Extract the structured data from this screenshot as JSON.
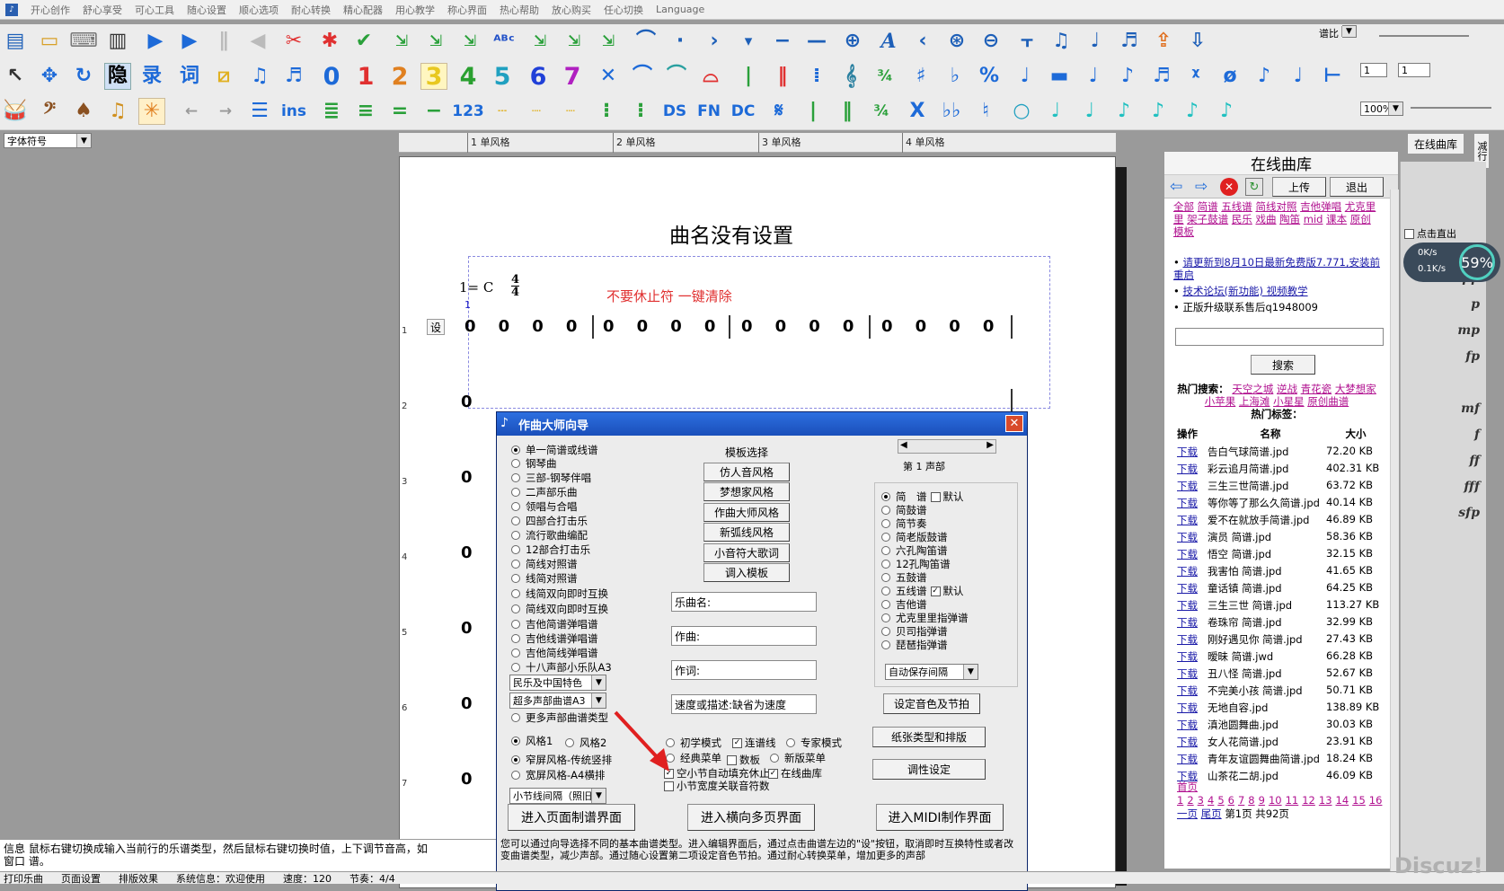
{
  "menu": [
    "开心创作",
    "舒心享受",
    "可心工具",
    "随心设置",
    "顺心选项",
    "耐心转换",
    "精心配器",
    "用心教学",
    "称心界面",
    "热心帮助",
    "放心购买",
    "任心切换",
    "Language"
  ],
  "toolbar_right": {
    "pubi_label": "谱比",
    "zoom": "100%",
    "field1": "1",
    "field2": "1"
  },
  "font_select": "字体符号",
  "ruler_labels": [
    "1 单风格",
    "2 单风格",
    "3 单风格",
    "4 单风格"
  ],
  "score": {
    "title": "曲名没有设置",
    "key": "1= C",
    "time_top": "4",
    "time_bottom": "4",
    "cursor_mark": "1",
    "notice": "不要休止符 一键清除",
    "set_label": "设",
    "measures": [
      [
        "0",
        "0",
        "0",
        "0"
      ],
      [
        "0",
        "0",
        "0",
        "0"
      ],
      [
        "0",
        "0",
        "0",
        "0"
      ],
      [
        "0",
        "0",
        "0",
        "0"
      ]
    ],
    "row_numbers": [
      "1",
      "2",
      "3",
      "4",
      "5",
      "6",
      "7"
    ],
    "rest": "0"
  },
  "dialog": {
    "title": "作曲大师向导",
    "left_options": [
      "单一简谱或线谱",
      "钢琴曲",
      "三部-钢琴伴唱",
      "二声部乐曲",
      "领唱与合唱",
      "四部合打击乐",
      "流行歌曲编配",
      "12部合打击乐",
      "简线对照谱",
      "线简对照谱",
      "线简双向即时互换",
      "简线双向即时互换",
      "吉他简谱弹唱谱",
      "吉他线谱弹唱谱",
      "吉他简线弹唱谱",
      "十八声部小乐队A3"
    ],
    "select1": "民乐及中国特色",
    "select2": "超多声部曲谱A3",
    "more_types": "更多声部曲谱类型",
    "style1": "风格1",
    "style2": "风格2",
    "narrow": "窄屏风格-传统竖排",
    "wide": "宽屏风格-A4横排",
    "spacing_select": "小节线间隔（照旧）",
    "template_heading": "模板选择",
    "template_buttons": [
      "仿人音风格",
      "梦想家风格",
      "作曲大师风格",
      "新弧线风格",
      "小音符大歌词",
      "调入模板"
    ],
    "fields": {
      "title_label": "乐曲名:",
      "composer_label": "作曲:",
      "lyricist_label": "作词:",
      "tempo_label": "速度或描述:缺省为速度"
    },
    "voice_label": "第 1 声部",
    "right_options": [
      "简　谱",
      "简鼓谱",
      "简节奏",
      "简老版鼓谱",
      "六孔陶笛谱",
      "12孔陶笛谱",
      "五鼓谱",
      "五线谱",
      "吉他谱",
      "尤克里里指弹谱",
      "贝司指弹谱",
      "琵琶指弹谱"
    ],
    "default_label": "默认",
    "autosave_select": "自动保存间隔",
    "set_timbre_btn": "设定音色及节拍",
    "paper_btn": "纸张类型和排版",
    "tune_btn": "调性设定",
    "modes": {
      "beginner": "初学模式",
      "connect": "连谱线",
      "expert": "专家模式",
      "classic": "经典菜单",
      "plate": "数板",
      "newmenu": "新版菜单",
      "autofill": "空小节自动填充休止",
      "online": "在线曲库",
      "width": "小节宽度关联音符数"
    },
    "enter_page": "进入页面制谱界面",
    "enter_horizontal": "进入横向多页界面",
    "enter_midi": "进入MIDI制作界面",
    "footer_text": "您可以通过向导选择不同的基本曲谱类型。进入编辑界面后，通过点击曲谱左边的\"设\"按钮，取消即时互换特性或者改变曲谱类型，减少声部。通过随心设置第二项设定音色节拍。通过耐心转换菜单，增加更多的声部"
  },
  "library": {
    "title": "在线曲库",
    "upload": "上传",
    "exit": "退出",
    "categories": [
      "全部",
      "简谱",
      "五线谱",
      "简线对照",
      "吉他弹唱",
      "尤克里里",
      "架子鼓谱",
      "民乐",
      "戏曲",
      "陶笛",
      "mid",
      "课本",
      "原创",
      "模板"
    ],
    "bullets": [
      "请更新到8月10日最新免费版7.771,安装前重启",
      "技术论坛(新功能) 视频教学",
      "正版升级联系售后q1948009"
    ],
    "search_btn": "搜索",
    "hot_search_label": "热门搜索：",
    "hot_search": [
      "天空之城",
      "逆战",
      "青花瓷",
      "大梦想家",
      "小苹果",
      "上海滩",
      "小星星",
      "原创曲谱"
    ],
    "hot_tags_label": "热门标签：",
    "col_op": "操作",
    "col_name": "名称",
    "col_size": "大小",
    "download": "下载",
    "files": [
      [
        "告白气球简谱.jpd",
        "72.20 KB"
      ],
      [
        "彩云追月简谱.jpd",
        "402.31 KB"
      ],
      [
        "三生三世简谱.jpd",
        "63.72 KB"
      ],
      [
        "等你等了那么久简谱.jpd",
        "40.14 KB"
      ],
      [
        "爱不在就放手简谱.jpd",
        "46.89 KB"
      ],
      [
        "演员 简谱.jpd",
        "58.36 KB"
      ],
      [
        "悟空 简谱.jpd",
        "32.15 KB"
      ],
      [
        "我害怕 简谱.jpd",
        "41.65 KB"
      ],
      [
        "童话镇 简谱.jpd",
        "64.25 KB"
      ],
      [
        "三生三世 简谱.jpd",
        "113.27 KB"
      ],
      [
        "卷珠帘 简谱.jpd",
        "32.99 KB"
      ],
      [
        "刚好遇见你 简谱.jpd",
        "27.43 KB"
      ],
      [
        "暧昧 简谱.jwd",
        "66.28 KB"
      ],
      [
        "丑八怪 简谱.jpd",
        "52.67 KB"
      ],
      [
        "不完美小孩 简谱.jpd",
        "50.71 KB"
      ],
      [
        "无地自容.jpd",
        "138.89 KB"
      ],
      [
        "滇池圆舞曲.jpd",
        "30.03 KB"
      ],
      [
        "女人花简谱.jpd",
        "23.91 KB"
      ],
      [
        "青年友谊圆舞曲简谱.jpd",
        "18.24 KB"
      ],
      [
        "山茶花二胡.jpd",
        "46.09 KB"
      ]
    ],
    "page_first": "首页",
    "pages": [
      "1",
      "2",
      "3",
      "4",
      "5",
      "6",
      "7",
      "8",
      "9",
      "10",
      "11",
      "12",
      "13",
      "14",
      "15",
      "16"
    ],
    "page_next": "一页",
    "page_last": "尾页",
    "page_info": "第1页 共92页"
  },
  "right_panel": {
    "online_tab": "在线曲库",
    "side_tab": "减行",
    "click_label": "点击直出",
    "speed_up": "0K/s",
    "speed_down": "0.1K/s",
    "percent": "59%"
  },
  "status": {
    "info": "信息 鼠标右键切换成输入当前行的乐谱类型，然后鼠标右键切换时值，上下调节音高，如",
    "info2": "窗口 谱。",
    "bar": [
      "打印乐曲",
      "页面设置",
      "排版效果",
      "系统信息：欢迎使用",
      "速度：120",
      "节奏：4/4"
    ]
  },
  "watermark": "Discuz!"
}
